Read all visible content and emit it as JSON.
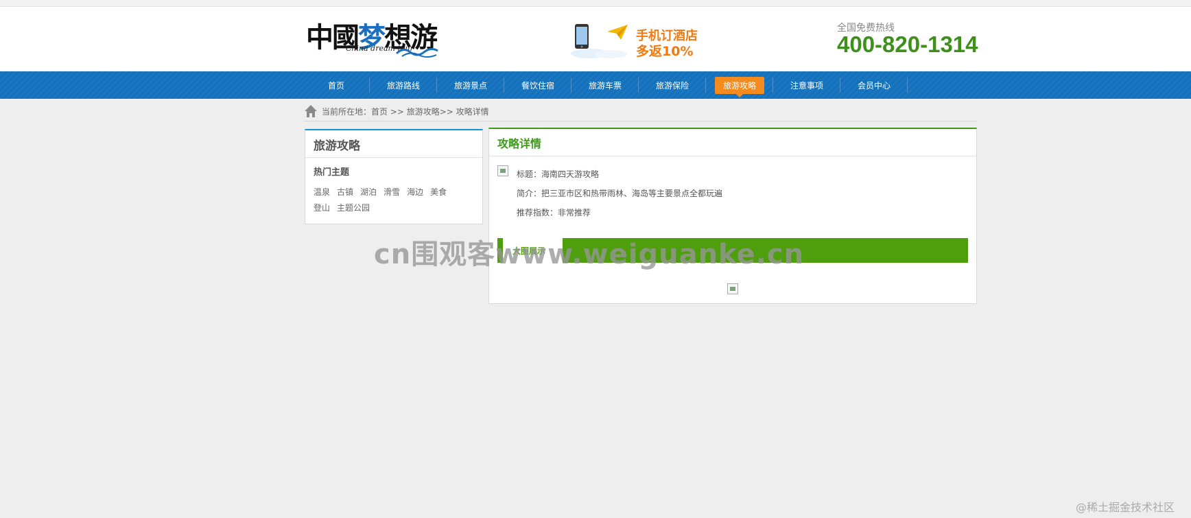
{
  "header": {
    "logo": {
      "cn_part1": "中國",
      "cn_part2": "梦",
      "cn_part3": "想游",
      "en": "China dream tour"
    },
    "promo": {
      "line1": "手机订酒店",
      "line2": "多返10%"
    },
    "hotline": {
      "label": "全国免费热线",
      "number": "400-820-1314"
    }
  },
  "nav": {
    "items": [
      {
        "label": "首页"
      },
      {
        "label": "旅游路线"
      },
      {
        "label": "旅游景点"
      },
      {
        "label": "餐饮住宿"
      },
      {
        "label": "旅游车票"
      },
      {
        "label": "旅游保险"
      },
      {
        "label": "旅游攻略",
        "active": true
      },
      {
        "label": "注意事项"
      },
      {
        "label": "会员中心"
      }
    ]
  },
  "breadcrumb": {
    "text": "当前所在地：首页 >> 旅游攻略>> 攻略详情"
  },
  "sidebar": {
    "title": "旅游攻略",
    "hot_title": "热门主题",
    "tags": [
      "温泉",
      "古镇",
      "湖泊",
      "滑雪",
      "海边",
      "美食",
      "登山",
      "主题公园"
    ]
  },
  "main": {
    "title": "攻略详情",
    "info": {
      "title": "标题：海南四天游攻略",
      "desc": "简介：把三亚市区和热带雨林、海岛等主要景点全都玩遍",
      "rating": "推荐指数：非常推荐"
    },
    "section_label": "大图展示"
  },
  "watermark": "cn围观客www.weiguanke.cn",
  "credit": "@稀土掘金技术社区",
  "colors": {
    "nav_blue": "#1670b9",
    "active_orange": "#f58a1f",
    "green": "#3f9a1c",
    "hotline_green": "#3f8f1d"
  }
}
